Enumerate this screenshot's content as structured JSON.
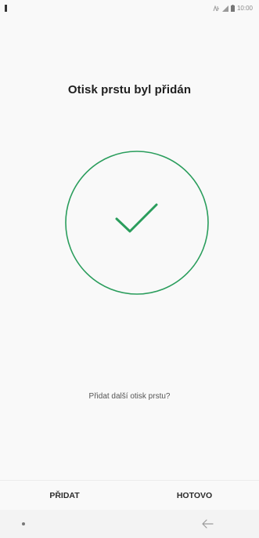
{
  "status_bar": {
    "time": "10:00",
    "icons": [
      "network-type-icon",
      "signal-icon",
      "battery-icon"
    ]
  },
  "screen": {
    "title": "Otisk prstu byl přidán",
    "success_icon": "check-circle-icon",
    "prompt": "Přidat další otisk prstu?"
  },
  "actions": {
    "add_label": "PŘIDAT",
    "done_label": "HOTOVO"
  },
  "nav_bar": {
    "icons": [
      "recent-apps-dot-icon",
      "back-arrow-icon"
    ]
  },
  "colors": {
    "accent_green": "#2a9d5c",
    "background": "#f9f9f9",
    "nav_background": "#f3f3f3"
  }
}
